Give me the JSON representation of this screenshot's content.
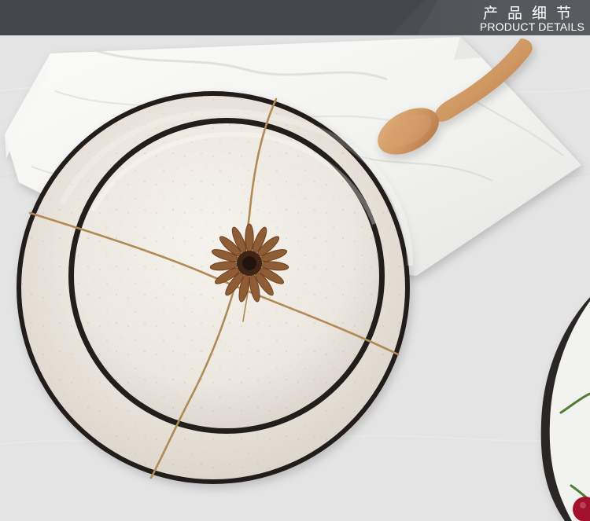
{
  "header": {
    "title_cn": "产品细节",
    "title_en": "PRODUCT DETAILS"
  },
  "colors": {
    "header_bg": "#4a4e52",
    "table_bg": "#e6e6e6",
    "plate_glaze": "#eee9e2",
    "plate_rim": "#24201e",
    "wood": "#d39a68",
    "twine": "#b28a58",
    "star_anise": "#8a5a35"
  },
  "scene": {
    "objects": [
      "white-napkin",
      "large-plate",
      "small-plate",
      "wooden-spoon",
      "twine",
      "star-anise",
      "side-plate",
      "red-berry"
    ]
  }
}
